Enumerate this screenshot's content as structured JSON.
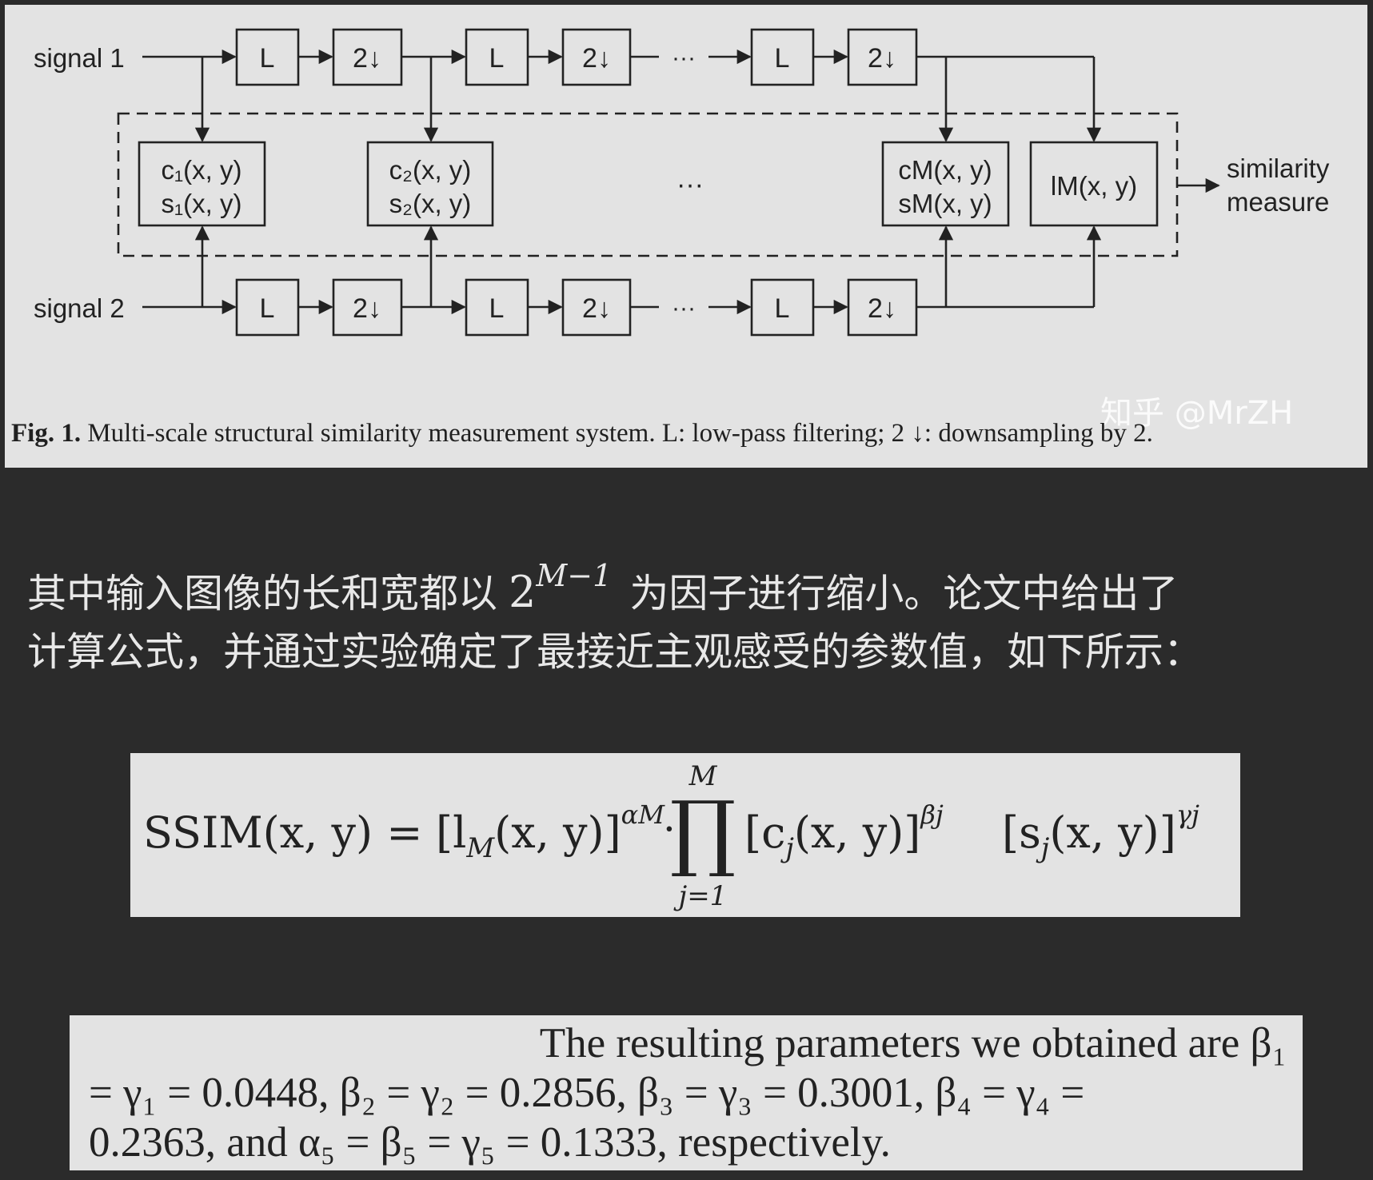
{
  "diagram": {
    "signal1_label": "signal 1",
    "signal2_label": "signal 2",
    "lowpass_label": "L",
    "down_label": "2",
    "down_arrow": "↓",
    "ellipsis": "···",
    "mid_ellipsis": "···",
    "block1_line1": "c₁(x, y)",
    "block1_line2": "s₁(x, y)",
    "block2_line1": "c₂(x, y)",
    "block2_line2": "s₂(x, y)",
    "blockM_line1": "cM(x, y)",
    "blockM_line2": "sM(x, y)",
    "blockL_label": "lM(x, y)",
    "output_line1": "similarity",
    "output_line2": "measure"
  },
  "caption": {
    "fig_label": "Fig. 1.",
    "text": " Multi-scale structural similarity measurement system. L: low-pass filtering; 2 ↓: downsampling by 2."
  },
  "watermark": "知乎 @MrZH",
  "paragraph": {
    "part1": "其中输入图像的长和宽都以",
    "math_base": "2",
    "math_exp": "M−1",
    "part2": "为因子进行缩小。论文中给出了",
    "line2": "计算公式，并通过实验确定了最接近主观感受的参数值，如下所示："
  },
  "formula": {
    "lhs": "SSIM(x, y) =",
    "term1": "[l",
    "term1_sub": "M",
    "term1_arg": "(x, y)]",
    "term1_exp": "αM",
    "dot": "·",
    "prod_top": "M",
    "prod_symbol": "∏",
    "prod_bottom": "j=1",
    "term2": "[c",
    "term2_sub": "j",
    "term2_arg": "(x, y)]",
    "term2_exp": "βj",
    "term3": "[s",
    "term3_sub": "j",
    "term3_arg": "(x, y)]",
    "term3_exp": "γj"
  },
  "params": {
    "line1": "The resulting parameters we obtained are β₁",
    "line2": "= γ₁ = 0.0448, β₂ = γ₂ = 0.2856, β₃ = γ₃ = 0.3001, β₄ = γ₄ =",
    "line3": "0.2363, and α₅ = β₅ = γ₅ = 0.1333, respectively."
  }
}
